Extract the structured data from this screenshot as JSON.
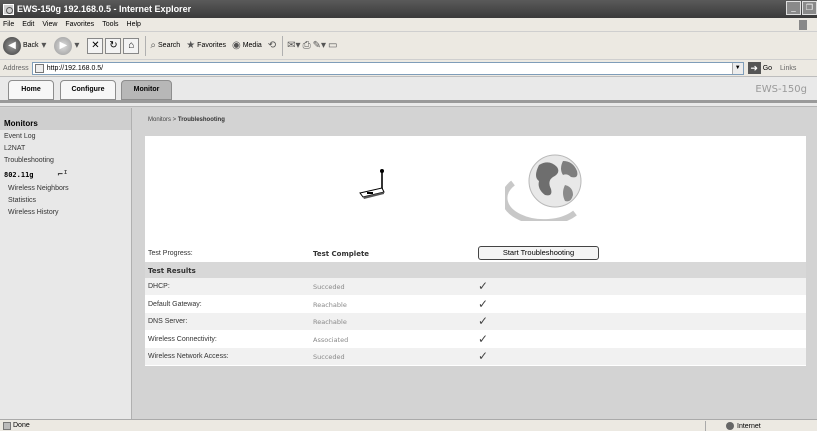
{
  "window": {
    "title": "EWS-150g 192.168.0.5 - Internet Explorer"
  },
  "menu": [
    "File",
    "Edit",
    "View",
    "Favorites",
    "Tools",
    "Help"
  ],
  "toolbar": {
    "back": "Back",
    "search": "Search",
    "favorites": "Favorites",
    "media": "Media"
  },
  "address": {
    "label": "Address",
    "url": "http://192.168.0.5/",
    "go": "Go",
    "links": "Links"
  },
  "tabs": [
    {
      "label": "Home"
    },
    {
      "label": "Configure"
    },
    {
      "label": "Monitor"
    }
  ],
  "brand": "EWS-150g",
  "sidebar": {
    "heading": "Monitors",
    "items": [
      {
        "label": "Event Log"
      },
      {
        "label": "L2NAT"
      },
      {
        "label": "Troubleshooting"
      }
    ],
    "group": "802.11g",
    "subitems": [
      {
        "label": "Wireless Neighbors"
      },
      {
        "label": "Statistics"
      },
      {
        "label": "Wireless History"
      }
    ]
  },
  "breadcrumb": {
    "parent": "Monitors >",
    "current": "Troubleshooting"
  },
  "progress": {
    "label": "Test Progress:",
    "value": "Test Complete",
    "button": "Start Troubleshooting"
  },
  "results": {
    "heading": "Test Results",
    "rows": [
      {
        "label": "DHCP:",
        "value": "Succeded",
        "check": "✓"
      },
      {
        "label": "Default Gateway:",
        "value": "Reachable",
        "check": "✓"
      },
      {
        "label": "DNS Server:",
        "value": "Reachable",
        "check": "✓"
      },
      {
        "label": "Wireless Connectivity:",
        "value": "Associated",
        "check": "✓"
      },
      {
        "label": "Wireless Network Access:",
        "value": "Succeded",
        "check": "✓"
      }
    ]
  },
  "status": {
    "text": "Done",
    "zone": "Internet"
  }
}
